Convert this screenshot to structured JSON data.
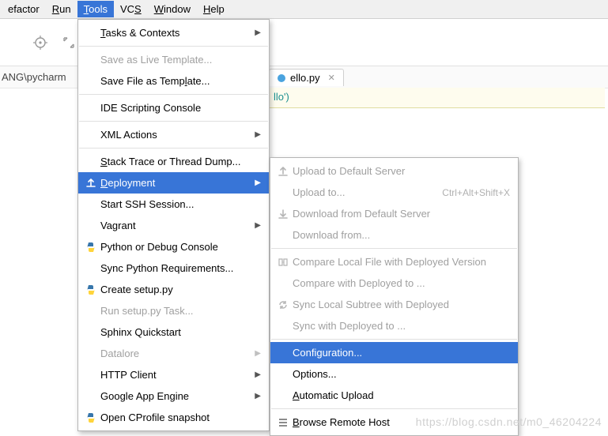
{
  "menubar": {
    "refactor": "efactor",
    "run": "Run",
    "tools": "Tools",
    "vcs": "VCS",
    "window": "Window",
    "help": "Help"
  },
  "path": "ANG\\pycharm",
  "editor": {
    "tab_name": "ello.py",
    "code_fragment": "llo')"
  },
  "tools_menu": {
    "tasks": "Tasks & Contexts",
    "save_live": "Save as Live Template...",
    "save_file": "Save File as Template...",
    "ide_scripting": "IDE Scripting Console",
    "xml_actions": "XML Actions",
    "stack_trace": "Stack Trace or Thread Dump...",
    "deployment": "Deployment",
    "ssh": "Start SSH Session...",
    "vagrant": "Vagrant",
    "python_console": "Python or Debug Console",
    "sync_reqs": "Sync Python Requirements...",
    "create_setup": "Create setup.py",
    "run_setup": "Run setup.py Task...",
    "sphinx": "Sphinx Quickstart",
    "datalore": "Datalore",
    "http_client": "HTTP Client",
    "gae": "Google App Engine",
    "cprofile": "Open CProfile snapshot"
  },
  "deploy_menu": {
    "upload_default": "Upload to Default Server",
    "upload_to": "Upload to...",
    "upload_to_sc": "Ctrl+Alt+Shift+X",
    "download_default": "Download from Default Server",
    "download_from": "Download from...",
    "compare_local": "Compare Local File with Deployed Version",
    "compare_with": "Compare with Deployed to ...",
    "sync_local": "Sync Local Subtree with Deployed",
    "sync_with": "Sync with Deployed to ...",
    "configuration": "Configuration...",
    "options": "Options...",
    "auto_upload": "Automatic Upload",
    "browse_remote": "Browse Remote Host"
  },
  "watermark": "https://blog.csdn.net/m0_46204224"
}
